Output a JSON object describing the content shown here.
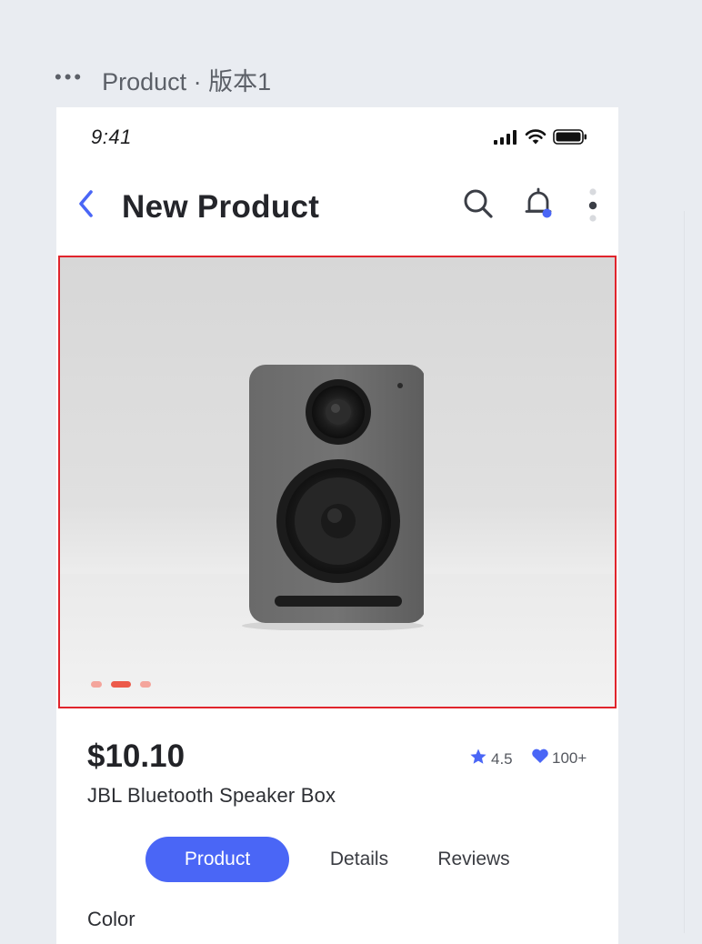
{
  "frame": {
    "menu_glyph": "•••",
    "name": "Product · 版本1"
  },
  "status_bar": {
    "time": "9:41",
    "icons": [
      "cellular-signal-icon",
      "wifi-icon",
      "battery-icon"
    ]
  },
  "nav": {
    "title": "New Product",
    "back_icon": "chevron-left-icon",
    "actions": [
      "search-icon",
      "bell-icon",
      "more-vertical-icon"
    ],
    "accent": "#4a66f6"
  },
  "hero": {
    "image": "speaker-photo",
    "carousel": {
      "count": 3,
      "active_index": 1,
      "active_color": "#ec5a4a",
      "inactive_color": "#f4a59c"
    },
    "border_color": "#e0242c"
  },
  "product": {
    "price": "$10.10",
    "name": "JBL Bluetooth Speaker Box",
    "rating": "4.5",
    "likes": "100+"
  },
  "tabs": [
    {
      "label": "Product",
      "active": true
    },
    {
      "label": "Details",
      "active": false
    },
    {
      "label": "Reviews",
      "active": false
    }
  ],
  "sections": {
    "color_label": "Color"
  }
}
